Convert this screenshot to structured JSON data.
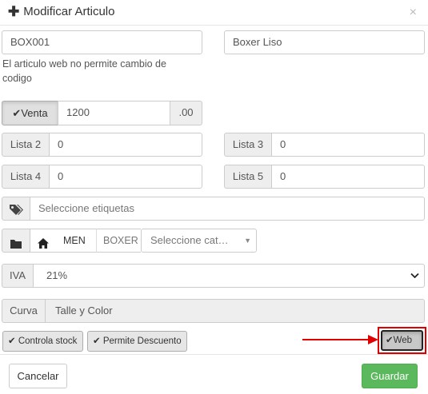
{
  "dialog": {
    "title": "Modificar Articulo",
    "close_glyph": "×",
    "header_icon": "plus-icon"
  },
  "codigo": {
    "value": "BOX001",
    "help": "El articulo web no permite cambio de codigo"
  },
  "nombre": {
    "value": "Boxer Liso"
  },
  "precio": {
    "venta_label": "Venta",
    "venta_value": "1200",
    "decimals": ".00",
    "lista2_label": "Lista 2",
    "lista2_value": "0",
    "lista3_label": "Lista 3",
    "lista3_value": "0",
    "lista4_label": "Lista 4",
    "lista4_value": "0",
    "lista5_label": "Lista 5",
    "lista5_value": "0"
  },
  "etiquetas": {
    "placeholder": "Seleccione etiquetas",
    "icon": "tags-icon"
  },
  "categoria": {
    "folder_icon": "folder-icon",
    "home_icon": "home-icon",
    "crumbs": [
      "MEN",
      "BOXER"
    ],
    "select_placeholder": "Seleccione cat…"
  },
  "iva": {
    "label": "IVA",
    "selected": "21%"
  },
  "curva": {
    "label": "Curva",
    "value": "Talle y Color"
  },
  "toggles": {
    "controla_stock": "Controla stock",
    "permite_descuento": "Permite Descuento",
    "web": "Web"
  },
  "annotation": {
    "highlight_color": "#e00000"
  },
  "footer": {
    "cancel": "Cancelar",
    "save": "Guardar"
  },
  "colors": {
    "success": "#5cb85c",
    "addon_bg": "#eeeeee",
    "border": "#cccccc"
  }
}
